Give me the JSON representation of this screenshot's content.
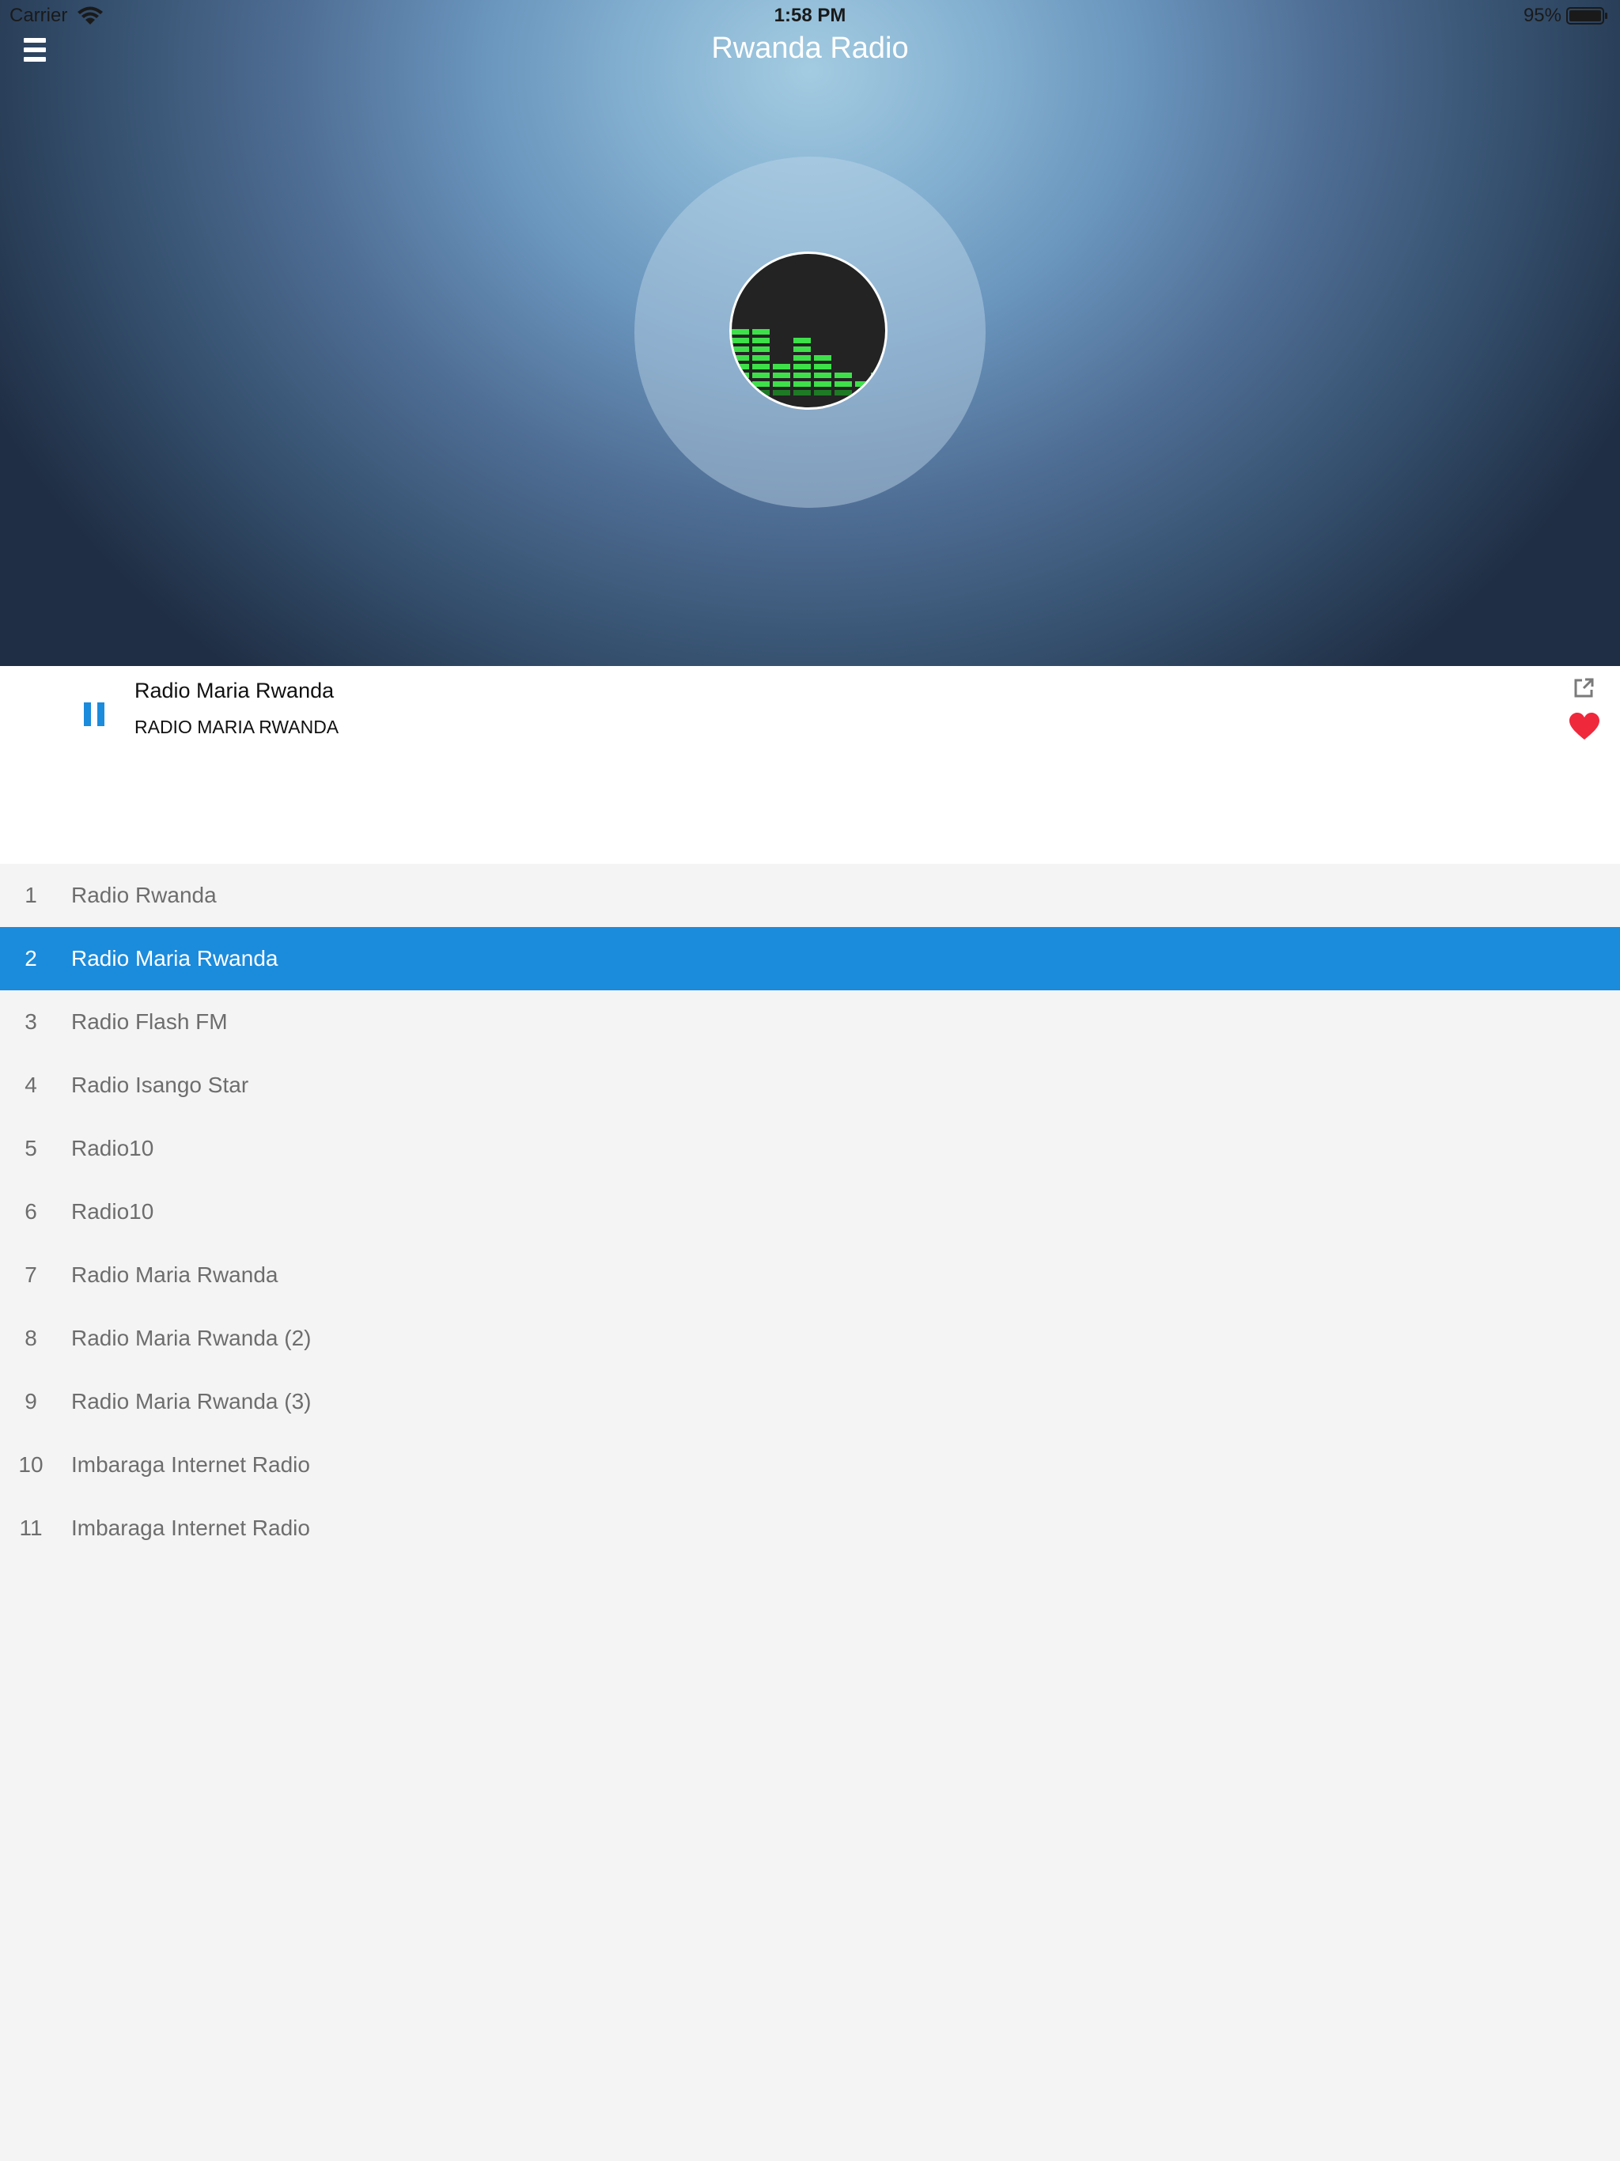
{
  "status_bar": {
    "carrier": "Carrier",
    "time": "1:58 PM",
    "battery": "95%"
  },
  "header": {
    "title": "Rwanda Radio"
  },
  "now_playing": {
    "title": "Radio Maria Rwanda",
    "subtitle": "RADIO MARIA RWANDA",
    "state": "playing"
  },
  "colors": {
    "accent": "#1b8bdc",
    "heart": "#f0283c",
    "list_bg": "#f4f4f4"
  },
  "stations": [
    {
      "num": "1",
      "name": "Radio Rwanda",
      "active": false
    },
    {
      "num": "2",
      "name": "Radio Maria Rwanda",
      "active": true
    },
    {
      "num": "3",
      "name": "Radio Flash FM",
      "active": false
    },
    {
      "num": "4",
      "name": "Radio Isango Star",
      "active": false
    },
    {
      "num": "5",
      "name": "Radio10",
      "active": false
    },
    {
      "num": "6",
      "name": "Radio10",
      "active": false
    },
    {
      "num": "7",
      "name": "Radio Maria Rwanda",
      "active": false
    },
    {
      "num": "8",
      "name": "Radio Maria Rwanda (2)",
      "active": false
    },
    {
      "num": "9",
      "name": "Radio Maria Rwanda (3)",
      "active": false
    },
    {
      "num": "10",
      "name": "Imbaraga Internet Radio",
      "active": false
    },
    {
      "num": "11",
      "name": "Imbaraga Internet Radio",
      "active": false
    }
  ]
}
